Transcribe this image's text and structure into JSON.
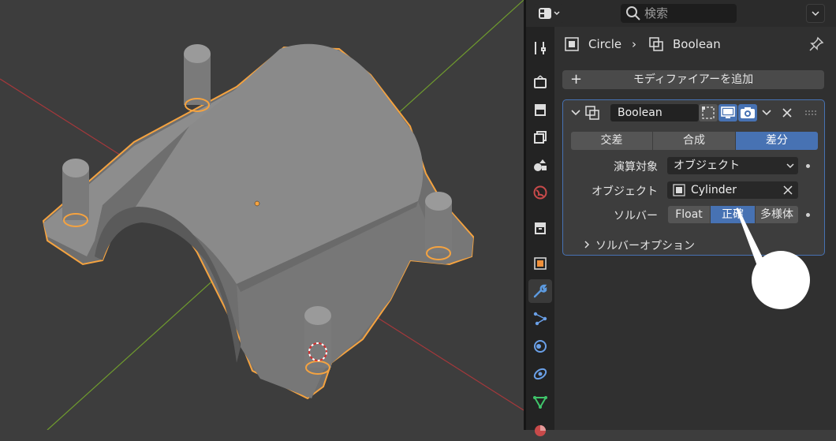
{
  "colors": {
    "viewport_bg": "#3d3d3d",
    "panel_bg": "#303030",
    "accent_blue": "#4772b3",
    "selection_orange": "#f5a340",
    "axis_red": "#a6383b",
    "axis_green": "#6f9b2e"
  },
  "header": {
    "editor_type_icon": "editor-type-icon",
    "search_placeholder": "検索"
  },
  "tabs": [
    {
      "name": "tool-icon"
    },
    {
      "name": "render-icon"
    },
    {
      "name": "output-icon"
    },
    {
      "name": "view-layer-icon"
    },
    {
      "name": "scene-icon"
    },
    {
      "name": "world-icon"
    },
    {
      "name": "collection-icon"
    },
    {
      "name": "object-icon"
    },
    {
      "name": "modifier-wrench-icon",
      "active": true
    },
    {
      "name": "particles-icon"
    },
    {
      "name": "physics-icon"
    },
    {
      "name": "constraints-icon"
    },
    {
      "name": "data-icon"
    },
    {
      "name": "material-icon"
    }
  ],
  "breadcrumb": {
    "object": "Circle",
    "separator": "›",
    "modifier": "Boolean"
  },
  "add_modifier_label": "モディファイアーを追加",
  "modifier": {
    "name": "Boolean",
    "operations": [
      "交差",
      "合成",
      "差分"
    ],
    "active_operation": "差分",
    "operand_label": "演算対象",
    "operand_value": "オブジェクト",
    "object_label": "オブジェクト",
    "object_value": "Cylinder",
    "solver_label": "ソルバー",
    "solvers": [
      "Float",
      "正確",
      "多様体"
    ],
    "active_solver": "正確",
    "solver_options_label": "ソルバーオプション"
  }
}
